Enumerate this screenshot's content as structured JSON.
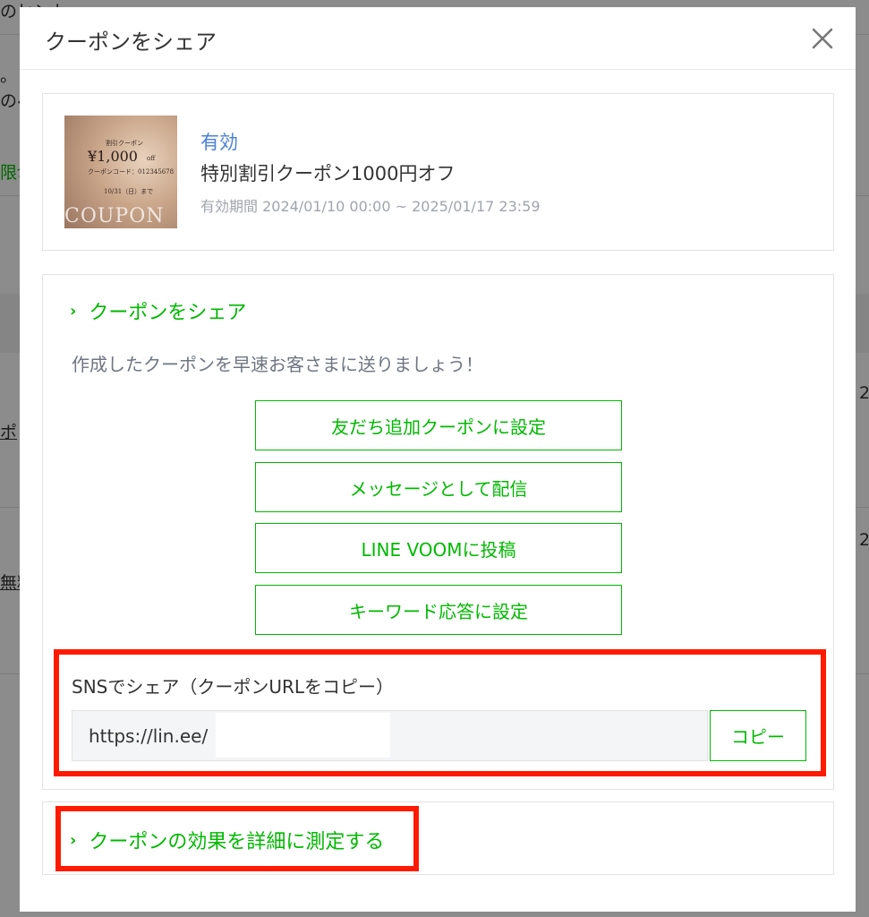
{
  "background": {
    "title_fragment": "のヒント",
    "text1": "。",
    "text2": "のペ",
    "link_text": "限切",
    "row1_link": "ポ",
    "row2_link": "無料",
    "row1_num": "2",
    "row2_num": "2"
  },
  "modal": {
    "title": "クーポンをシェア",
    "close_icon": "close-icon"
  },
  "coupon": {
    "thumb_label": "割引クーポン",
    "thumb_price": "¥1,000",
    "thumb_unit": "off",
    "thumb_code": "クーポンコード：012345678",
    "thumb_until": "10/31（日）まで",
    "thumb_big": "COUPON",
    "status": "有効",
    "name": "特別割引クーポン1000円オフ",
    "period": "有効期間 2024/01/10 00:00 ~ 2025/01/17 23:59"
  },
  "share": {
    "heading": "クーポンをシェア",
    "description": "作成したクーポンを早速お客さまに送りましょう！",
    "buttons": [
      "友だち追加クーポンに設定",
      "メッセージとして配信",
      "LINE VOOMに投稿",
      "キーワード応答に設定"
    ],
    "sns_label": "SNSでシェア（クーポンURLをコピー）",
    "url_value": "https://lin.ee/",
    "copy_label": "コピー"
  },
  "measure": {
    "link": "クーポンの効果を詳細に測定する"
  },
  "colors": {
    "accent_green": "#00b900",
    "status_blue": "#4a7fd6",
    "highlight_red": "#ff1a00"
  }
}
